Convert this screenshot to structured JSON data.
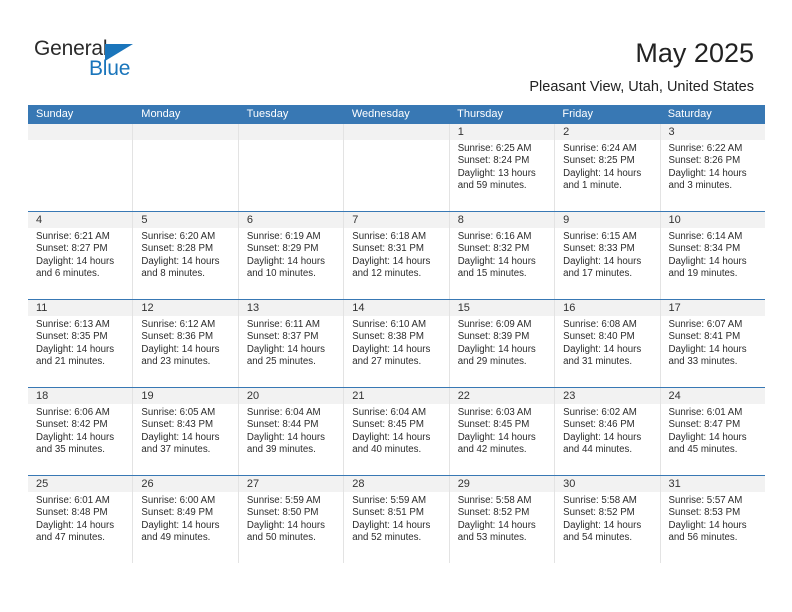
{
  "brand": {
    "name_part1": "General",
    "name_part2": "Blue",
    "triangle_color": "#1a75bb",
    "text_color": "#2b2b2b"
  },
  "header": {
    "title": "May 2025",
    "subtitle": "Pleasant View, Utah, United States",
    "header_bg_color": "#3878b4",
    "daynum_band_color": "#f2f2f2"
  },
  "calendar": {
    "weekday_headers": [
      "Sunday",
      "Monday",
      "Tuesday",
      "Wednesday",
      "Thursday",
      "Friday",
      "Saturday"
    ],
    "weeks": [
      [
        {
          "day": "",
          "empty": true
        },
        {
          "day": "",
          "empty": true
        },
        {
          "day": "",
          "empty": true
        },
        {
          "day": "",
          "empty": true
        },
        {
          "day": "1",
          "sunrise": "Sunrise: 6:25 AM",
          "sunset": "Sunset: 8:24 PM",
          "daylight_line1": "Daylight: 13 hours",
          "daylight_line2": "and 59 minutes."
        },
        {
          "day": "2",
          "sunrise": "Sunrise: 6:24 AM",
          "sunset": "Sunset: 8:25 PM",
          "daylight_line1": "Daylight: 14 hours",
          "daylight_line2": "and 1 minute."
        },
        {
          "day": "3",
          "sunrise": "Sunrise: 6:22 AM",
          "sunset": "Sunset: 8:26 PM",
          "daylight_line1": "Daylight: 14 hours",
          "daylight_line2": "and 3 minutes."
        }
      ],
      [
        {
          "day": "4",
          "sunrise": "Sunrise: 6:21 AM",
          "sunset": "Sunset: 8:27 PM",
          "daylight_line1": "Daylight: 14 hours",
          "daylight_line2": "and 6 minutes."
        },
        {
          "day": "5",
          "sunrise": "Sunrise: 6:20 AM",
          "sunset": "Sunset: 8:28 PM",
          "daylight_line1": "Daylight: 14 hours",
          "daylight_line2": "and 8 minutes."
        },
        {
          "day": "6",
          "sunrise": "Sunrise: 6:19 AM",
          "sunset": "Sunset: 8:29 PM",
          "daylight_line1": "Daylight: 14 hours",
          "daylight_line2": "and 10 minutes."
        },
        {
          "day": "7",
          "sunrise": "Sunrise: 6:18 AM",
          "sunset": "Sunset: 8:31 PM",
          "daylight_line1": "Daylight: 14 hours",
          "daylight_line2": "and 12 minutes."
        },
        {
          "day": "8",
          "sunrise": "Sunrise: 6:16 AM",
          "sunset": "Sunset: 8:32 PM",
          "daylight_line1": "Daylight: 14 hours",
          "daylight_line2": "and 15 minutes."
        },
        {
          "day": "9",
          "sunrise": "Sunrise: 6:15 AM",
          "sunset": "Sunset: 8:33 PM",
          "daylight_line1": "Daylight: 14 hours",
          "daylight_line2": "and 17 minutes."
        },
        {
          "day": "10",
          "sunrise": "Sunrise: 6:14 AM",
          "sunset": "Sunset: 8:34 PM",
          "daylight_line1": "Daylight: 14 hours",
          "daylight_line2": "and 19 minutes."
        }
      ],
      [
        {
          "day": "11",
          "sunrise": "Sunrise: 6:13 AM",
          "sunset": "Sunset: 8:35 PM",
          "daylight_line1": "Daylight: 14 hours",
          "daylight_line2": "and 21 minutes."
        },
        {
          "day": "12",
          "sunrise": "Sunrise: 6:12 AM",
          "sunset": "Sunset: 8:36 PM",
          "daylight_line1": "Daylight: 14 hours",
          "daylight_line2": "and 23 minutes."
        },
        {
          "day": "13",
          "sunrise": "Sunrise: 6:11 AM",
          "sunset": "Sunset: 8:37 PM",
          "daylight_line1": "Daylight: 14 hours",
          "daylight_line2": "and 25 minutes."
        },
        {
          "day": "14",
          "sunrise": "Sunrise: 6:10 AM",
          "sunset": "Sunset: 8:38 PM",
          "daylight_line1": "Daylight: 14 hours",
          "daylight_line2": "and 27 minutes."
        },
        {
          "day": "15",
          "sunrise": "Sunrise: 6:09 AM",
          "sunset": "Sunset: 8:39 PM",
          "daylight_line1": "Daylight: 14 hours",
          "daylight_line2": "and 29 minutes."
        },
        {
          "day": "16",
          "sunrise": "Sunrise: 6:08 AM",
          "sunset": "Sunset: 8:40 PM",
          "daylight_line1": "Daylight: 14 hours",
          "daylight_line2": "and 31 minutes."
        },
        {
          "day": "17",
          "sunrise": "Sunrise: 6:07 AM",
          "sunset": "Sunset: 8:41 PM",
          "daylight_line1": "Daylight: 14 hours",
          "daylight_line2": "and 33 minutes."
        }
      ],
      [
        {
          "day": "18",
          "sunrise": "Sunrise: 6:06 AM",
          "sunset": "Sunset: 8:42 PM",
          "daylight_line1": "Daylight: 14 hours",
          "daylight_line2": "and 35 minutes."
        },
        {
          "day": "19",
          "sunrise": "Sunrise: 6:05 AM",
          "sunset": "Sunset: 8:43 PM",
          "daylight_line1": "Daylight: 14 hours",
          "daylight_line2": "and 37 minutes."
        },
        {
          "day": "20",
          "sunrise": "Sunrise: 6:04 AM",
          "sunset": "Sunset: 8:44 PM",
          "daylight_line1": "Daylight: 14 hours",
          "daylight_line2": "and 39 minutes."
        },
        {
          "day": "21",
          "sunrise": "Sunrise: 6:04 AM",
          "sunset": "Sunset: 8:45 PM",
          "daylight_line1": "Daylight: 14 hours",
          "daylight_line2": "and 40 minutes."
        },
        {
          "day": "22",
          "sunrise": "Sunrise: 6:03 AM",
          "sunset": "Sunset: 8:45 PM",
          "daylight_line1": "Daylight: 14 hours",
          "daylight_line2": "and 42 minutes."
        },
        {
          "day": "23",
          "sunrise": "Sunrise: 6:02 AM",
          "sunset": "Sunset: 8:46 PM",
          "daylight_line1": "Daylight: 14 hours",
          "daylight_line2": "and 44 minutes."
        },
        {
          "day": "24",
          "sunrise": "Sunrise: 6:01 AM",
          "sunset": "Sunset: 8:47 PM",
          "daylight_line1": "Daylight: 14 hours",
          "daylight_line2": "and 45 minutes."
        }
      ],
      [
        {
          "day": "25",
          "sunrise": "Sunrise: 6:01 AM",
          "sunset": "Sunset: 8:48 PM",
          "daylight_line1": "Daylight: 14 hours",
          "daylight_line2": "and 47 minutes."
        },
        {
          "day": "26",
          "sunrise": "Sunrise: 6:00 AM",
          "sunset": "Sunset: 8:49 PM",
          "daylight_line1": "Daylight: 14 hours",
          "daylight_line2": "and 49 minutes."
        },
        {
          "day": "27",
          "sunrise": "Sunrise: 5:59 AM",
          "sunset": "Sunset: 8:50 PM",
          "daylight_line1": "Daylight: 14 hours",
          "daylight_line2": "and 50 minutes."
        },
        {
          "day": "28",
          "sunrise": "Sunrise: 5:59 AM",
          "sunset": "Sunset: 8:51 PM",
          "daylight_line1": "Daylight: 14 hours",
          "daylight_line2": "and 52 minutes."
        },
        {
          "day": "29",
          "sunrise": "Sunrise: 5:58 AM",
          "sunset": "Sunset: 8:52 PM",
          "daylight_line1": "Daylight: 14 hours",
          "daylight_line2": "and 53 minutes."
        },
        {
          "day": "30",
          "sunrise": "Sunrise: 5:58 AM",
          "sunset": "Sunset: 8:52 PM",
          "daylight_line1": "Daylight: 14 hours",
          "daylight_line2": "and 54 minutes."
        },
        {
          "day": "31",
          "sunrise": "Sunrise: 5:57 AM",
          "sunset": "Sunset: 8:53 PM",
          "daylight_line1": "Daylight: 14 hours",
          "daylight_line2": "and 56 minutes."
        }
      ]
    ]
  }
}
